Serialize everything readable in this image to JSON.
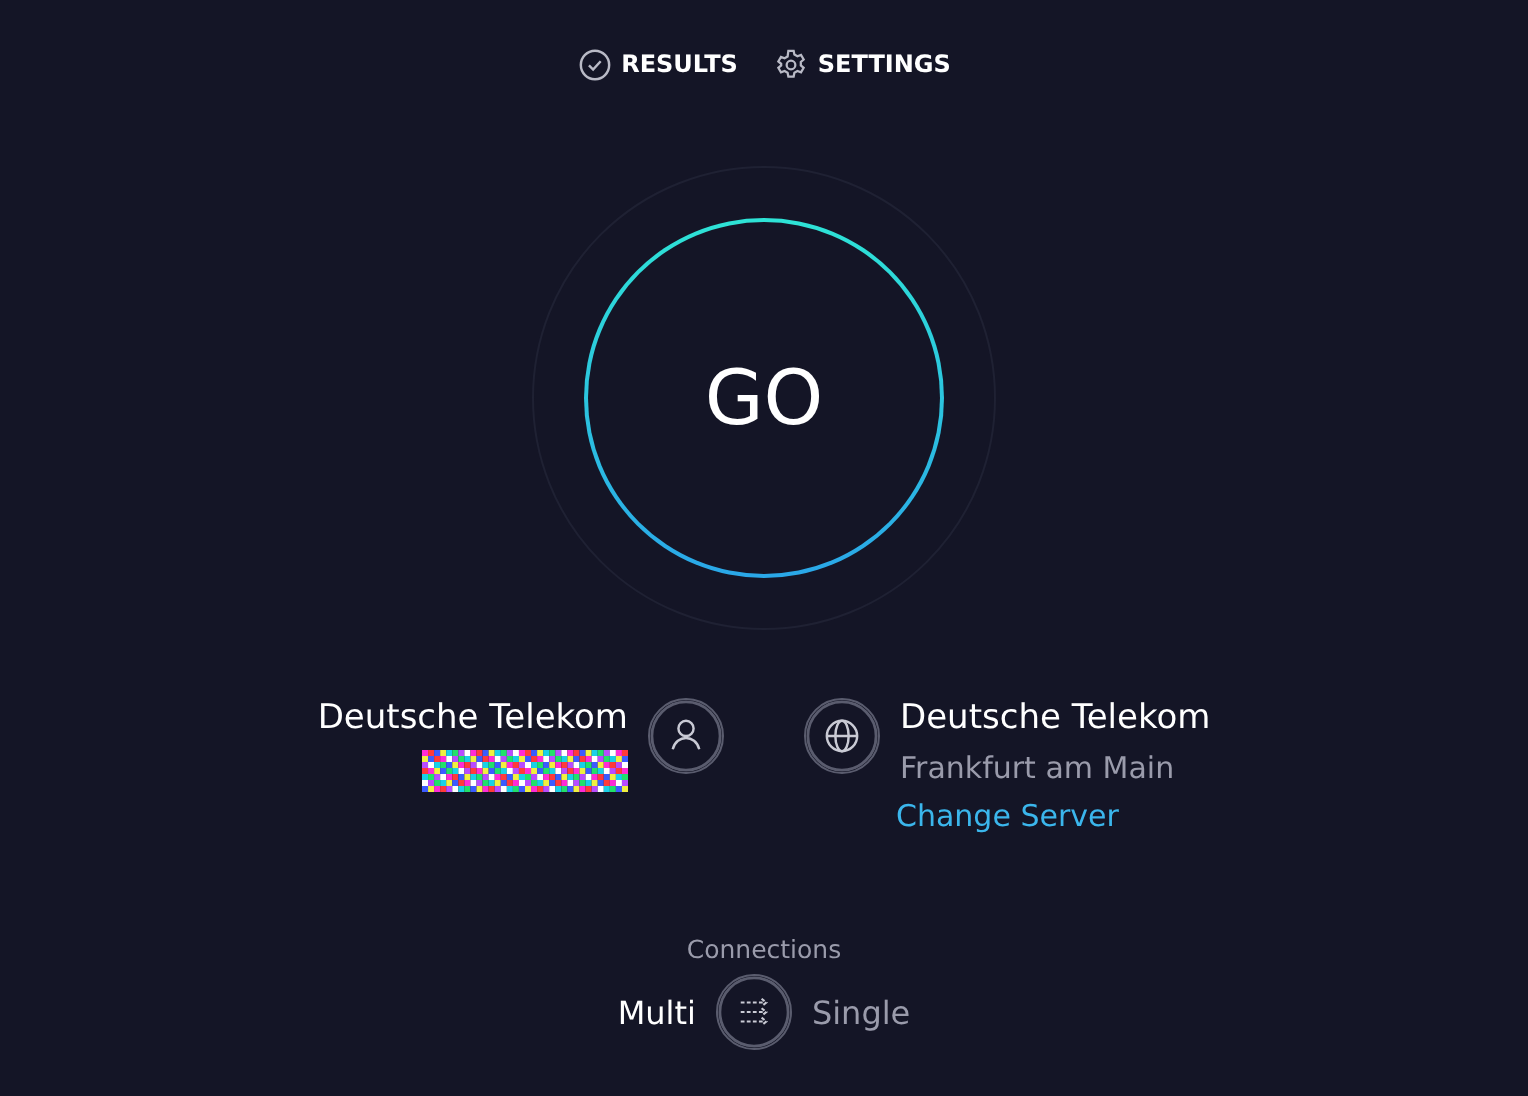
{
  "nav": [
    {
      "kind": "results",
      "label": "RESULTS"
    },
    {
      "kind": "settings",
      "label": "SETTINGS"
    }
  ],
  "go_button": {
    "label": "GO"
  },
  "provider": {
    "name": "Deutsche Telekom",
    "ip_redacted": true
  },
  "server": {
    "name": "Deutsche Telekom",
    "location": "Frankfurt am Main",
    "change_link": "Change Server"
  },
  "connections": {
    "label": "Connections",
    "options": [
      {
        "label": "Multi",
        "selected": true
      },
      {
        "label": "Single",
        "selected": false
      }
    ]
  }
}
